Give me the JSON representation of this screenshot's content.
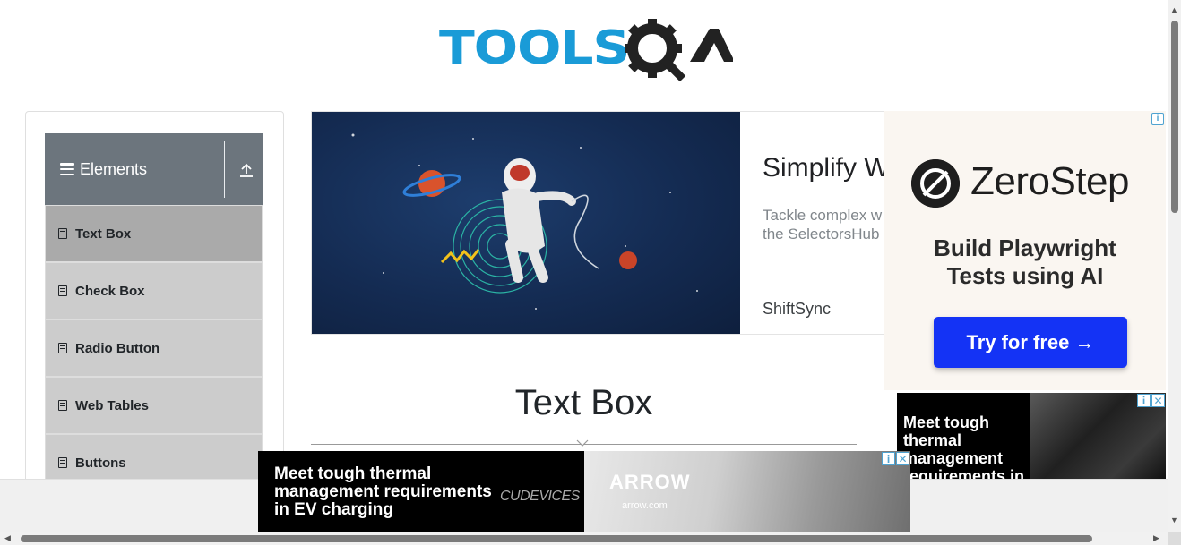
{
  "header": {
    "logo_text_tools": "TOOLS",
    "logo_text_qa": "QA"
  },
  "sidebar": {
    "group_title": "Elements",
    "items": [
      {
        "label": "Text Box",
        "active": true
      },
      {
        "label": "Check Box"
      },
      {
        "label": "Radio Button"
      },
      {
        "label": "Web Tables"
      },
      {
        "label": "Buttons"
      }
    ]
  },
  "banner_ad": {
    "title": "Simplify W",
    "description_line1": "Tackle complex w",
    "description_line2": "the SelectorsHub",
    "brand": "ShiftSync"
  },
  "main": {
    "page_title": "Text Box"
  },
  "right_ad": {
    "brand": "ZeroStep",
    "headline_line1": "Build Playwright",
    "headline_line2": "Tests using AI",
    "cta_label": "Try for free →",
    "adchoice": "i"
  },
  "small_ad": {
    "text": "Meet tough thermal management requirements in",
    "info_icon": "i",
    "close_icon": "✕"
  },
  "bottom_ad": {
    "text": "Meet tough thermal management requirements in EV charging",
    "partner_brand": "CUDEVICES",
    "brand": "ARROW",
    "domain": "arrow.com",
    "info_icon": "i",
    "close_icon": "✕"
  },
  "colors": {
    "accent_blue": "#1a9bd7",
    "sidebar_header": "#6c757d",
    "menu_item": "#cccccc",
    "menu_item_active": "#aaaaaa",
    "cta_blue": "#1433f5"
  }
}
